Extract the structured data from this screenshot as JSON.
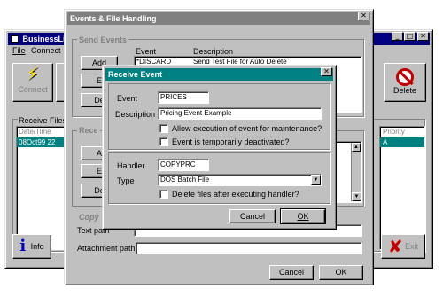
{
  "main_window": {
    "title": "BusinessLi",
    "menu": [
      "File",
      "Connect"
    ],
    "connect_label": "Connect",
    "delete_label": "Delete",
    "receive_files_label": "Receive Files",
    "col_datetime": "Date/Time",
    "col_priority": "Priority",
    "row_datetime": "08Oct99  22",
    "row_priority": "A",
    "info_label": "Info",
    "exit_label": "Exit"
  },
  "events_window": {
    "title": "Events & File Handling",
    "send_events_label": "Send Events",
    "col_event": "Event",
    "col_description": "Description",
    "row_event": "*DISCARD",
    "row_description": "Send Test File for Auto Delete",
    "add_label": "Add",
    "e_label": "E",
    "de_label": "De",
    "receive_label": "Rece",
    "a_label": "A",
    "e2_label": "E",
    "de2_label": "De",
    "copy_label": "Copy",
    "text_path_label": "Text path",
    "attachment_path_label": "Attachment path",
    "cancel_label": "Cancel",
    "ok_label": "OK"
  },
  "receive_dialog": {
    "title": "Receive Event",
    "event_label": "Event",
    "event_value": "PRICES",
    "description_label": "Description",
    "description_value": "Pricing Event Example",
    "allow_maintenance_label": "Allow execution of event for maintenance?",
    "deactivated_label": "Event is temporarily deactivated?",
    "handler_label": "Handler",
    "handler_value": "COPYPRC",
    "type_label": "Type",
    "type_value": "DOS Batch File",
    "delete_files_label": "Delete files after executing handler?",
    "cancel_label": "Cancel",
    "ok_label": "OK"
  }
}
